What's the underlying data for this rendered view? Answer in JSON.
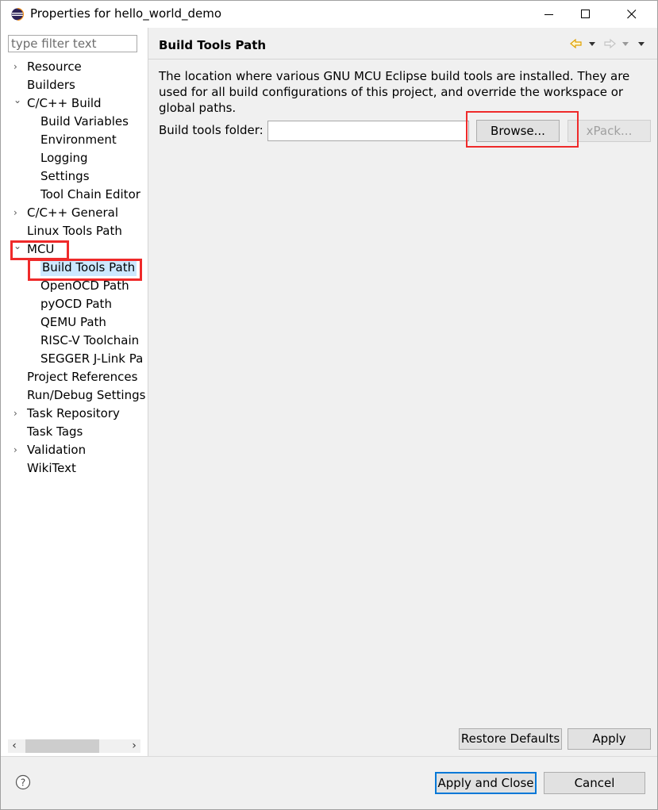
{
  "window": {
    "title": "Properties for hello_world_demo"
  },
  "left": {
    "filter_placeholder": "type filter text",
    "tree": [
      {
        "label": "Resource",
        "level": 0,
        "expander": "collapsed"
      },
      {
        "label": "Builders",
        "level": 0,
        "expander": "none"
      },
      {
        "label": "C/C++ Build",
        "level": 0,
        "expander": "expanded"
      },
      {
        "label": "Build Variables",
        "level": 1,
        "expander": "none"
      },
      {
        "label": "Environment",
        "level": 1,
        "expander": "none"
      },
      {
        "label": "Logging",
        "level": 1,
        "expander": "none"
      },
      {
        "label": "Settings",
        "level": 1,
        "expander": "none"
      },
      {
        "label": "Tool Chain Editor",
        "level": 1,
        "expander": "none"
      },
      {
        "label": "C/C++ General",
        "level": 0,
        "expander": "collapsed"
      },
      {
        "label": "Linux Tools Path",
        "level": 0,
        "expander": "none"
      },
      {
        "label": "MCU",
        "level": 0,
        "expander": "expanded"
      },
      {
        "label": "Build Tools Path",
        "level": 1,
        "expander": "none",
        "selected": true
      },
      {
        "label": "OpenOCD Path",
        "level": 1,
        "expander": "none"
      },
      {
        "label": "pyOCD Path",
        "level": 1,
        "expander": "none"
      },
      {
        "label": "QEMU Path",
        "level": 1,
        "expander": "none"
      },
      {
        "label": "RISC-V Toolchain",
        "level": 1,
        "expander": "none"
      },
      {
        "label": "SEGGER J-Link Pa",
        "level": 1,
        "expander": "none"
      },
      {
        "label": "Project References",
        "level": 0,
        "expander": "none"
      },
      {
        "label": "Run/Debug Settings",
        "level": 0,
        "expander": "none"
      },
      {
        "label": "Task Repository",
        "level": 0,
        "expander": "collapsed"
      },
      {
        "label": "Task Tags",
        "level": 0,
        "expander": "none"
      },
      {
        "label": "Validation",
        "level": 0,
        "expander": "collapsed"
      },
      {
        "label": "WikiText",
        "level": 0,
        "expander": "none"
      }
    ]
  },
  "main": {
    "title": "Build Tools Path",
    "description": "The location where various GNU MCU Eclipse build tools are installed. They are used for all build configurations of this project, and override the workspace or global paths.",
    "folder_label": "Build tools folder:",
    "folder_value": "",
    "browse_label": "Browse...",
    "xpack_label": "xPack...",
    "restore_label": "Restore Defaults",
    "apply_label": "Apply"
  },
  "footer": {
    "apply_close_label": "Apply and Close",
    "cancel_label": "Cancel"
  },
  "colors": {
    "selection": "#cce8ff",
    "annotation_red": "#ef2a2a",
    "default_button_border": "#0078d7",
    "nav_arrow": "#e0a000"
  }
}
